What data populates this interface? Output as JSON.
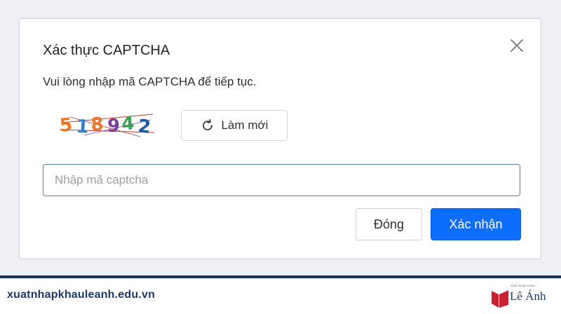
{
  "dialog": {
    "title": "Xác thực CAPTCHA",
    "message": "Vui lòng nhập mã CAPTCHA để tiếp tục.",
    "captcha_code": "518942",
    "captcha_digit_colors": [
      "#e8792a",
      "#3b7fc4",
      "#e8792a",
      "#7b3fa0",
      "#3b9f57",
      "#1f5aa8"
    ],
    "refresh_label": "Làm mới",
    "input_placeholder": "Nhập mã captcha",
    "input_value": "",
    "close_label": "Đóng",
    "confirm_label": "Xác nhận"
  },
  "footer": {
    "url": "xuatnhapkhauleanh.edu.vn",
    "logo_tagline": "XUẤT NHẬP KHẨU",
    "logo_name": "Lê Ánh"
  },
  "colors": {
    "primary": "#0d6efd",
    "footer_brand": "#1b3a68",
    "logo_red": "#c8202f"
  },
  "icons": {
    "close": "close-icon",
    "refresh": "refresh-icon"
  }
}
